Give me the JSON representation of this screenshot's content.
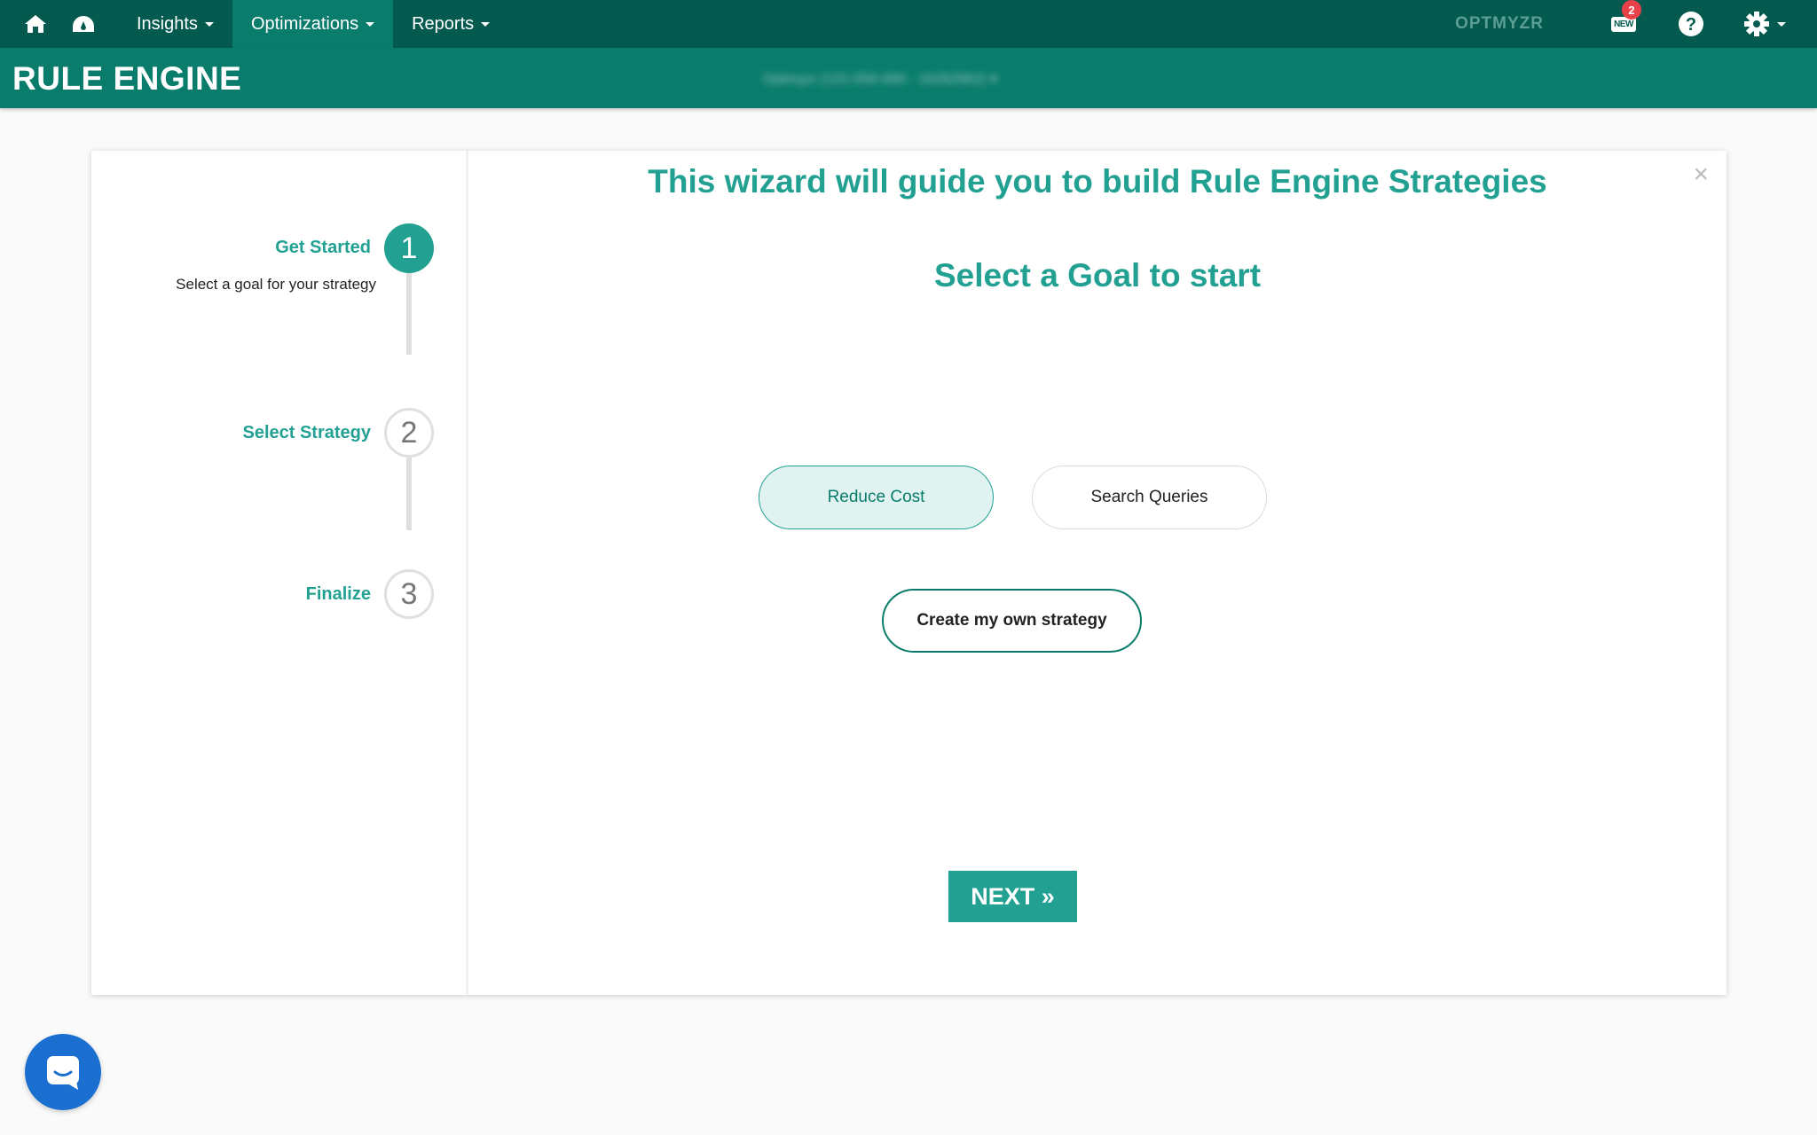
{
  "nav": {
    "home_icon": "home-icon",
    "dashboard_icon": "dashboard-icon",
    "items": [
      {
        "label": "Insights"
      },
      {
        "label": "Optimizations"
      },
      {
        "label": "Reports"
      }
    ],
    "brand": "OPTMYZR",
    "new_label": "NEW",
    "notification_count": "2",
    "help_icon": "help-icon",
    "settings_icon": "gear-icon"
  },
  "header": {
    "title": "RULE ENGINE",
    "account": "Optmyzr (131-056-690 - 16262862) ▾"
  },
  "wizard": {
    "heading": "This wizard will guide you to build Rule Engine Strategies",
    "close": "×",
    "steps": [
      {
        "number": "1",
        "label": "Get Started",
        "description": "Select a goal for your strategy"
      },
      {
        "number": "2",
        "label": "Select Strategy"
      },
      {
        "number": "3",
        "label": "Finalize"
      }
    ],
    "goal_title": "Select a Goal to start",
    "goals": [
      {
        "label": "Reduce Cost",
        "selected": true
      },
      {
        "label": "Search Queries",
        "selected": false
      }
    ],
    "own_strategy": "Create my own strategy",
    "next": "NEXT »"
  },
  "colors": {
    "nav_bg": "#045a4e",
    "header_bg": "#0a7c6c",
    "accent": "#22a193",
    "badge": "#e8414a",
    "chat": "#1a6fd1"
  },
  "chat_icon": "chat-icon"
}
